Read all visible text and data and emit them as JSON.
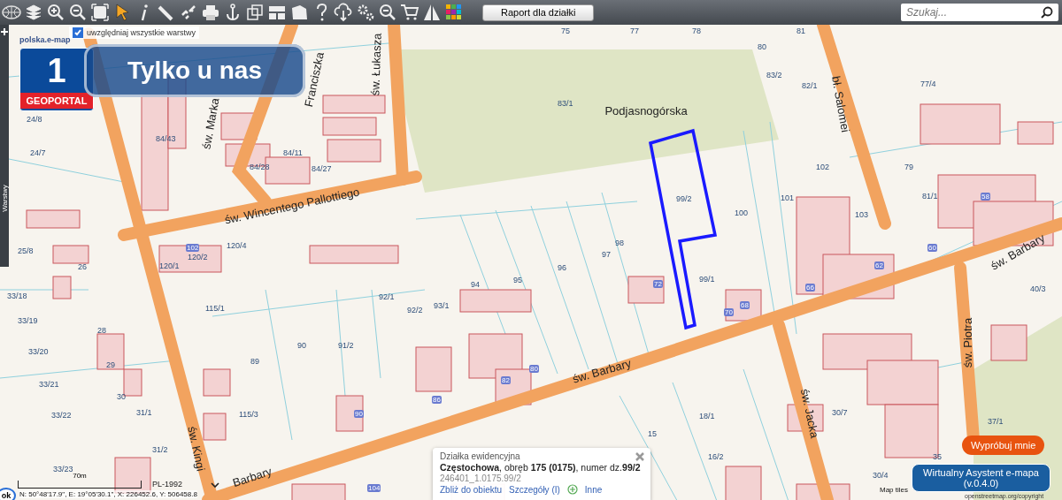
{
  "toolbar": {
    "report_button": "Raport dla działki",
    "search": {
      "placeholder": "Szukaj..."
    }
  },
  "side_panel": {
    "tab": "Warstwy"
  },
  "layers_option": {
    "label": "uwzględniaj wszystkie warstwy",
    "checked": true
  },
  "logo": {
    "number": "1",
    "name": "GEOPORTAL",
    "site": "polska.e-map"
  },
  "promo_banner": {
    "text": "Tylko u nas"
  },
  "map": {
    "streets": [
      "św. Wincentego Pallottiego",
      "św. Barbary",
      "św. Barbary",
      "św. Marka",
      "Franciszka",
      "św. Łukasza",
      "bł. Salomei",
      "św. Piotra",
      "św. Jacka",
      "św. Kingi",
      "Barbary",
      "Podjasnogórska"
    ],
    "parcels": [
      "83/1",
      "99/2",
      "100",
      "101",
      "98",
      "97",
      "96",
      "95",
      "94",
      "93/1",
      "92/2",
      "92/1",
      "91/2",
      "90",
      "89",
      "99/1",
      "79",
      "75",
      "77",
      "78",
      "80",
      "81",
      "83/2",
      "82/1",
      "102",
      "103",
      "24/8",
      "24/7",
      "25/8",
      "26",
      "28",
      "29",
      "30",
      "33/18",
      "33/19",
      "33/20",
      "33/21",
      "33/22",
      "33/23",
      "115/1",
      "115/3",
      "120/1",
      "120/2",
      "120/4",
      "31/1",
      "31/2",
      "15",
      "16/2",
      "18/1",
      "35",
      "30/4",
      "30/7",
      "37/1",
      "40/3",
      "77/4",
      "81/1",
      "84/43",
      "84/11",
      "84/28",
      "84/27"
    ],
    "houses": [
      "72",
      "70",
      "68",
      "66",
      "62",
      "60",
      "58",
      "82",
      "80",
      "86",
      "90",
      "104",
      "102"
    ]
  },
  "parcel_popup": {
    "title": "Działka ewidencyjna",
    "description": "**Częstochowa**, obręb **175 (0175)**, numer dz.**99/2**",
    "identifier": "246401_1.0175.99/2",
    "links": [
      "Zbliż do obiektu",
      "Szczegóły (I)",
      "Inne"
    ]
  },
  "scale": {
    "distance": "70m",
    "projection": "PL-1992",
    "coordinates": "N: 50°48'17.9\", E: 19°05'30.1\", X: 226452.6, Y: 506458.8",
    "ok": "ok"
  },
  "attribution": {
    "prefix": "Map tiles",
    "link": "openstreetmap.org/copyright"
  },
  "assistant": {
    "try_me": "Wypróbuj mnie",
    "title": "Wirtualny Asystent e-mapa",
    "version": "(v.0.4.0)"
  }
}
